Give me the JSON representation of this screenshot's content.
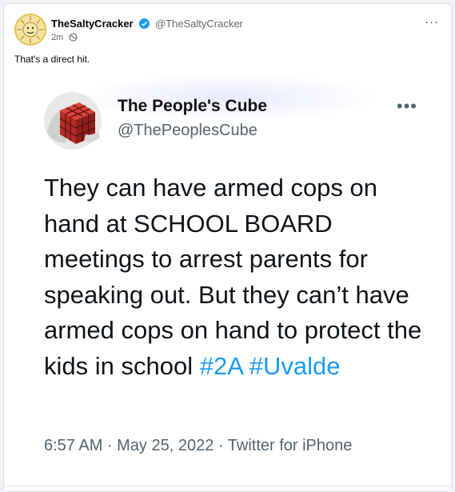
{
  "post": {
    "author_name": "TheSaltyCracker",
    "author_handle": "@TheSaltyCracker",
    "time": "2m",
    "caption": "That's a direct hit.",
    "menu_label": "···"
  },
  "embedded_tweet": {
    "name": "The People's Cube",
    "handle": "@ThePeoplesCube",
    "menu_label": "•••",
    "body_text": "They can have armed cops on hand at SCHOOL BOARD meetings to arrest parents for speaking out. But they can’t have armed cops on hand to protect the kids in school ",
    "hashtags": [
      "#2A",
      "#Uvalde"
    ],
    "meta": "6:57 AM · May 25, 2022 · Twitter for iPhone"
  },
  "colors": {
    "verified": "#1d9bf0",
    "hashtag": "#1d9bf0",
    "cube_red": "#c0302a"
  },
  "icons": [
    "avatar",
    "verified-badge-icon",
    "globe-icon",
    "more-options-icon",
    "cube-avatar"
  ]
}
